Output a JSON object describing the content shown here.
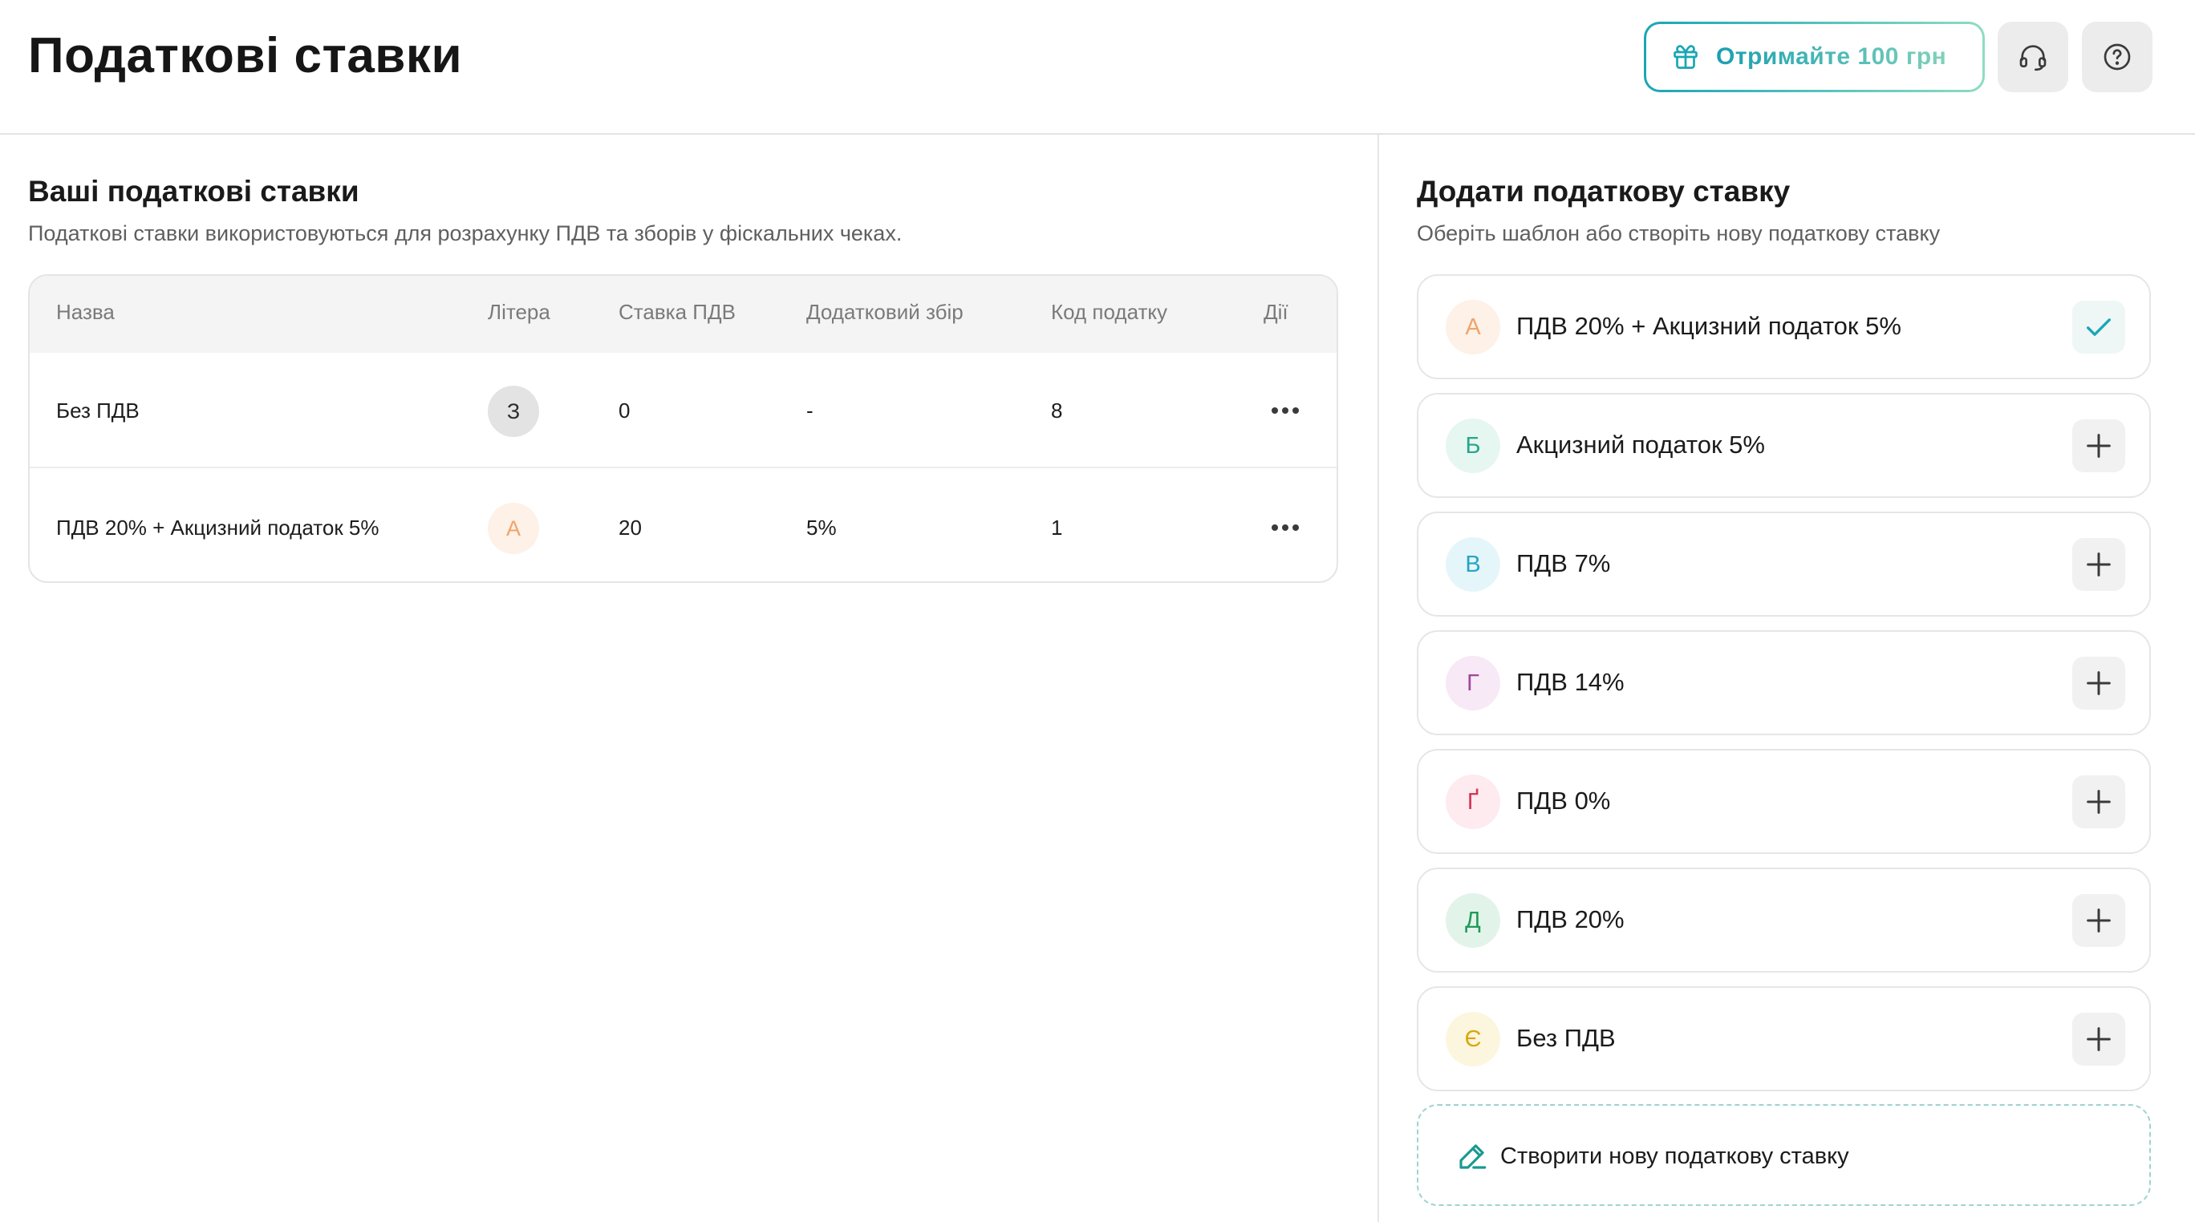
{
  "header": {
    "title": "Податкові ставки",
    "promo_label": "Отримайте 100 грн"
  },
  "rates_section": {
    "title": "Ваші податкові ставки",
    "subtitle": "Податкові ставки використовуються для розрахунку ПДВ та зборів у фіскальних чеках.",
    "columns": [
      "Назва",
      "Літера",
      "Ставка ПДВ",
      "Додатковий збір",
      "Код податку",
      "Дії"
    ],
    "rows": [
      {
        "name": "Без ПДВ",
        "letter": "З",
        "vat": "0",
        "extra": "-",
        "code": "8"
      },
      {
        "name": "ПДВ 20% + Акцизний податок 5%",
        "letter": "А",
        "vat": "20",
        "extra": "5%",
        "code": "1"
      }
    ]
  },
  "add_section": {
    "title": "Додати податкову ставку",
    "subtitle": "Оберіть шаблон або створіть нову податкову ставку",
    "templates": [
      {
        "letter": "А",
        "name": "ПДВ 20% + Акцизний податок 5%",
        "added": true
      },
      {
        "letter": "Б",
        "name": "Акцизний податок 5%",
        "added": false
      },
      {
        "letter": "В",
        "name": "ПДВ 7%",
        "added": false
      },
      {
        "letter": "Г",
        "name": "ПДВ 14%",
        "added": false
      },
      {
        "letter": "Ґ",
        "name": "ПДВ 0%",
        "added": false
      },
      {
        "letter": "Д",
        "name": "ПДВ 20%",
        "added": false
      },
      {
        "letter": "Є",
        "name": "Без ПДВ",
        "added": false
      }
    ],
    "create_label": "Створити нову податкову ставку"
  },
  "colors": {
    "accent": "#1aa6b4",
    "letter_z_bg": "#e3e3e3",
    "letter_a": "#f0a46a",
    "letter_a_bg": "#fdf1e8",
    "letter_b": "#27a68a",
    "letter_b_bg": "#e6f6f1",
    "letter_v": "#27a4c4",
    "letter_v_bg": "#e5f6fb",
    "letter_h": "#a0479b",
    "letter_h_bg": "#f8e9f6",
    "letter_g": "#d2365a",
    "letter_g_bg": "#fdebef",
    "letter_d": "#1f9a57",
    "letter_d_bg": "#e2f4ea",
    "letter_ye": "#d9a70c",
    "letter_ye_bg": "#fdf6de"
  }
}
